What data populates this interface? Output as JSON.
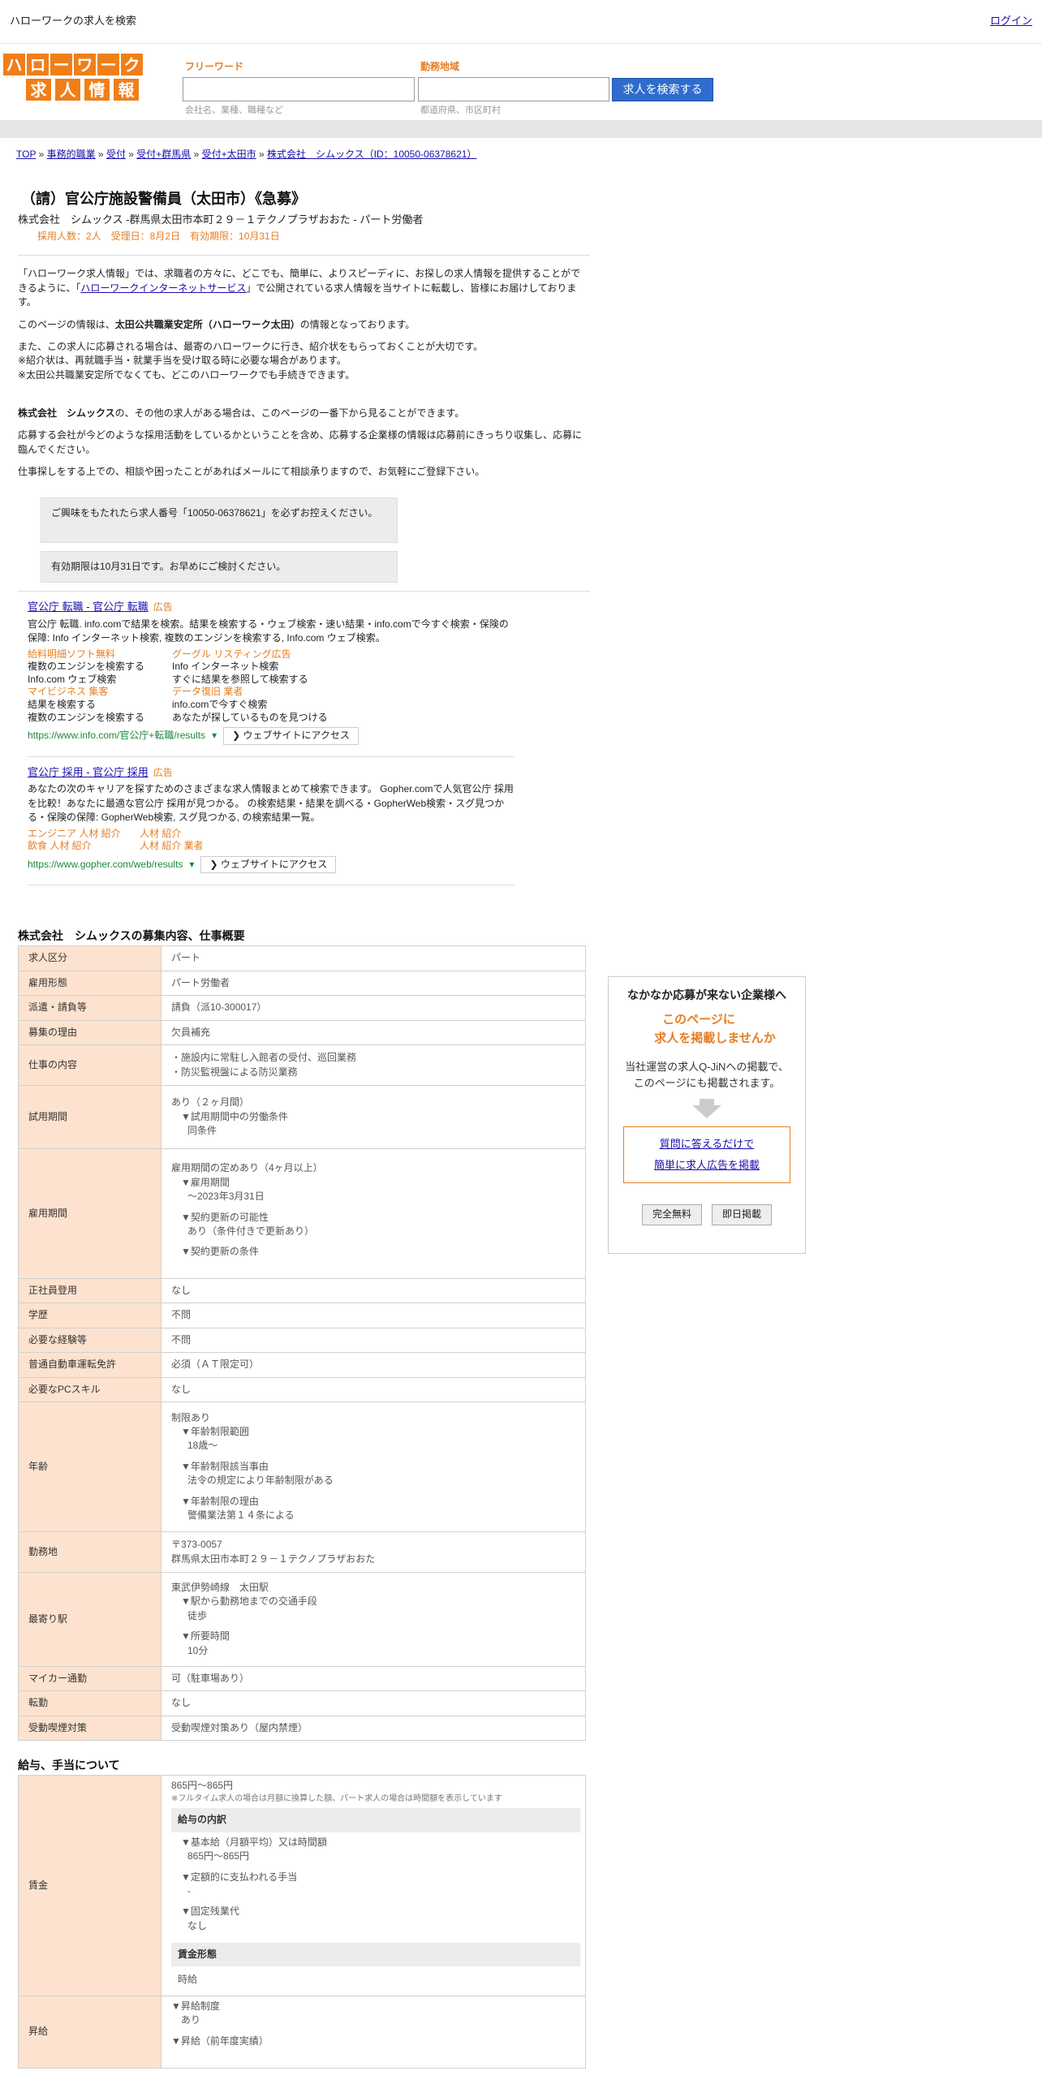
{
  "topbar": {
    "title": "ハローワークの求人を検索",
    "login": "ログイン"
  },
  "logo": {
    "row1": [
      "ハ",
      "ロ",
      "ー",
      "ワ",
      "ー",
      "ク"
    ],
    "row2": [
      "求",
      "人",
      "情",
      "報"
    ]
  },
  "search": {
    "keyword_label": "フリーワード",
    "keyword_placeholder": "会社名、業種、職種など",
    "area_label": "勤務地域",
    "area_placeholder": "都道府県、市区町村",
    "button": "求人を検索する"
  },
  "breadcrumb": [
    {
      "label": "TOP"
    },
    {
      "label": "事務的職業"
    },
    {
      "label": "受付"
    },
    {
      "label": "受付+群馬県"
    },
    {
      "label": "受付+太田市"
    },
    {
      "label": "株式会社　シムックス（ID：10050-06378621）"
    }
  ],
  "job": {
    "title": "（請）官公庁施設警備員（太田市）《急募》",
    "subtitle": "株式会社　シムックス -群馬県太田市本町２９－１テクノプラザおおた - パート労働者",
    "meta": "採用人数：2人　受理日：8月2日　有効期限：10月31日"
  },
  "intro": {
    "p1_a": "「ハローワーク求人情報」では、求職者の方々に、どこでも、簡単に、よりスピーディに、お探しの求人情報を提供することができるように、「",
    "p1_link": "ハローワークインターネットサービス",
    "p1_b": "」で公開されている求人情報を当サイトに転載し、皆様にお届けしております。",
    "p2_a": "このページの情報は、",
    "p2_bold": "太田公共職業安定所（ハローワーク太田）",
    "p2_b": "の情報となっております。",
    "p3_l1": "また、この求人に応募される場合は、最寄のハローワークに行き、紹介状をもらっておくことが大切です。",
    "p3_l2": "※紹介状は、再就職手当・就業手当を受け取る時に必要な場合があります。",
    "p3_l3": "※太田公共職業安定所でなくても、どこのハローワークでも手続きできます。",
    "p4_bold": "株式会社　シムックス",
    "p4_b": "の、その他の求人がある場合は、このページの一番下から見ることができます。",
    "p5": "応募する会社が今どのような採用活動をしているかということを含め、応募する企業様の情報は応募前にきっちり収集し、応募に臨んでください。",
    "p6": "仕事探しをする上での、相談や困ったことがあればメールにて相談承りますので、お気軽にご登録下さい。",
    "box1": "ご興味をもたれたら求人番号「10050-06378621」を必ずお控えください。",
    "box2": "有効期限は10月31日です。お早めにご検討ください。"
  },
  "ads": [
    {
      "title": "官公庁 転職 - 官公庁 転職",
      "tag": "広告",
      "desc": "官公庁 転職. info.comで結果を検索。結果を検索する・ウェブ検索・速い結果・info.comで今すぐ検索・保険の保障: Info インターネット検索, 複数のエンジンを検索する, Info.com ウェブ検索。",
      "sitelinks": [
        {
          "o": "給料明細ソフト無料",
          "l1": "複数のエンジンを検索する",
          "l2": "Info.com ウェブ検索"
        },
        {
          "o": "グーグル リスティング広告",
          "l1": "Info インターネット検索",
          "l2": "すぐに結果を参照して検索する"
        },
        {
          "o": "マイビジネス 集客",
          "l1": "結果を検索する",
          "l2": "複数のエンジンを検索する"
        },
        {
          "o": "データ復旧 業者",
          "l1": "info.comで今すぐ検索",
          "l2": "あなたが探しているものを見つける"
        }
      ],
      "url": "https://www.info.com/官公庁+転職/results",
      "visit": "❯ ウェブサイトにアクセス"
    },
    {
      "title": "官公庁 採用 - 官公庁 採用",
      "tag": "広告",
      "desc": "あなたの次のキャリアを探すためのさまざまな求人情報まとめて検索できます。 Gopher.comで人気官公庁 採用を比較！あなたに最適な官公庁 採用が見つかる。 の検索結果・結果を調べる・GopherWeb検索・スグ見つかる・保険の保障: GopherWeb検索, スグ見つかる, の検索結果一覧。",
      "links": [
        "エンジニア 人材 紹介",
        "人材 紹介",
        "飲食 人材 紹介",
        "人材 紹介 業者"
      ],
      "url": "https://www.gopher.com/web/results",
      "visit": "❯ ウェブサイトにアクセス"
    }
  ],
  "table1": {
    "heading": "株式会社　シムックスの募集内容、仕事概要",
    "rows": {
      "kyujin_kubun": {
        "h": "求人区分",
        "v": "パート"
      },
      "koyo_keitai": {
        "h": "雇用形態",
        "v": "パート労働者"
      },
      "haken": {
        "h": "派遣・請負等",
        "v": "請負（派10-300017）"
      },
      "riyu": {
        "h": "募集の理由",
        "v": "欠員補充"
      },
      "shigoto": {
        "h": "仕事の内容",
        "v1": "・施設内に常駐し入館者の受付、巡回業務",
        "v2": "・防災監視盤による防災業務"
      },
      "shiyo": {
        "h": "試用期間",
        "v1": "あり（２ヶ月間）",
        "v2": "▼試用期間中の労働条件",
        "v3": "同条件"
      },
      "koyo_kikan": {
        "h": "雇用期間",
        "v1": "雇用期間の定めあり（4ヶ月以上）",
        "v2": "▼雇用期間",
        "v3": "〜2023年3月31日",
        "v4": "▼契約更新の可能性",
        "v5": "あり（条件付きで更新あり）",
        "v6": "▼契約更新の条件"
      },
      "seishain": {
        "h": "正社員登用",
        "v": "なし"
      },
      "gakureki": {
        "h": "学歴",
        "v": "不問"
      },
      "keiken": {
        "h": "必要な経験等",
        "v": "不問"
      },
      "menkyo": {
        "h": "普通自動車運転免許",
        "v": "必須（ＡＴ限定可）"
      },
      "pc": {
        "h": "必要なPCスキル",
        "v": "なし"
      },
      "nenrei": {
        "h": "年齢",
        "v1": "制限あり",
        "v2": "▼年齢制限範囲",
        "v3": "18歳〜",
        "v4": "▼年齢制限該当事由",
        "v5": "法令の規定により年齢制限がある",
        "v6": "▼年齢制限の理由",
        "v7": "警備業法第１４条による"
      },
      "kinmuchi": {
        "h": "勤務地",
        "v1": "〒373-0057",
        "v2": "群馬県太田市本町２９－１テクノプラザおおた"
      },
      "eki": {
        "h": "最寄り駅",
        "v1": "東武伊勢崎線　太田駅",
        "v2": "▼駅から勤務地までの交通手段",
        "v3": "徒歩",
        "v4": "▼所要時間",
        "v5": "10分"
      },
      "mycar": {
        "h": "マイカー通勤",
        "v": "可（駐車場あり）"
      },
      "tenkin": {
        "h": "転勤",
        "v": "なし"
      },
      "judo": {
        "h": "受動喫煙対策",
        "v": "受動喫煙対策あり（屋内禁煙）"
      }
    }
  },
  "table2": {
    "heading": "給与、手当について",
    "chingin": {
      "h": "賃金",
      "v1": "865円〜865円",
      "note": "※フルタイム求人の場合は月額に換算した額、パート求人の場合は時間額を表示しています",
      "sec1": "給与の内訳",
      "a1": "▼基本給（月額平均）又は時間額",
      "a2": "865円〜865円",
      "a3": "▼定額的に支払われる手当",
      "a4": "-",
      "a5": "▼固定残業代",
      "a6": "なし",
      "sec2": "賃金形態",
      "b1": "時給"
    },
    "shokyu": {
      "h": "昇給",
      "v1": "▼昇給制度",
      "v2": "あり",
      "v3": "▼昇給（前年度実績）"
    }
  },
  "side": {
    "title": "なかなか応募が来ない企業様へ",
    "orange1": "このページに",
    "orange2": "求人を掲載しませんか",
    "desc1": "当社運営の求人Q-JiNへの掲載で、",
    "desc2": "このページにも掲載されます。",
    "link1": "質問に答えるだけで",
    "link2": "簡単に求人広告を掲載",
    "btn1": "完全無料",
    "btn2": "即日掲載"
  }
}
